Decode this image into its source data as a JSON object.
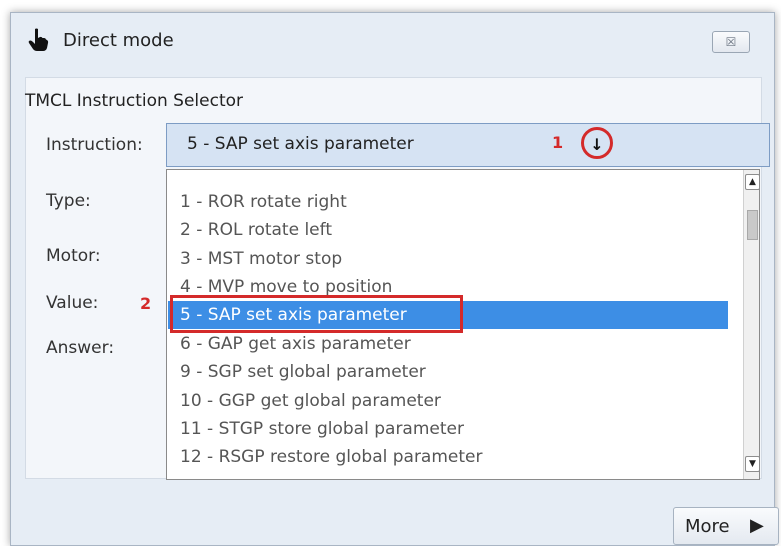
{
  "window": {
    "title": "Direct mode",
    "title_icon": "hand-pointer-icon",
    "close_glyph": "☒"
  },
  "panel": {
    "title": "TMCL Instruction Selector",
    "labels": {
      "instruction": "Instruction:",
      "type": "Type:",
      "motor": "Motor:",
      "value": "Value:",
      "answer": "Answer:"
    }
  },
  "combo": {
    "selected_value": "5 - SAP set axis parameter",
    "arrow_icon": "down-arrow-icon",
    "arrow_glyph": "↓"
  },
  "dropdown": {
    "items": [
      "1 - ROR rotate right",
      "2 - ROL rotate left",
      "3 - MST motor stop",
      "4 - MVP move to position",
      "5 - SAP set axis parameter",
      "6 - GAP get axis parameter",
      "9 - SGP set global parameter",
      "10 - GGP get global parameter",
      "11 - STGP store global parameter",
      "12 - RSGP restore global parameter"
    ],
    "selected_index": 4,
    "scroll_up_glyph": "▲",
    "scroll_down_glyph": "▼"
  },
  "annotations": {
    "marker_1": "1",
    "marker_2": "2",
    "color": "#d42a2a"
  },
  "buttons": {
    "more_label": "More",
    "more_arrow": "▶"
  },
  "colors": {
    "selection": "#3d8ee5",
    "combo_background": "#d6e3f3",
    "window_background": "#e6edf5"
  }
}
